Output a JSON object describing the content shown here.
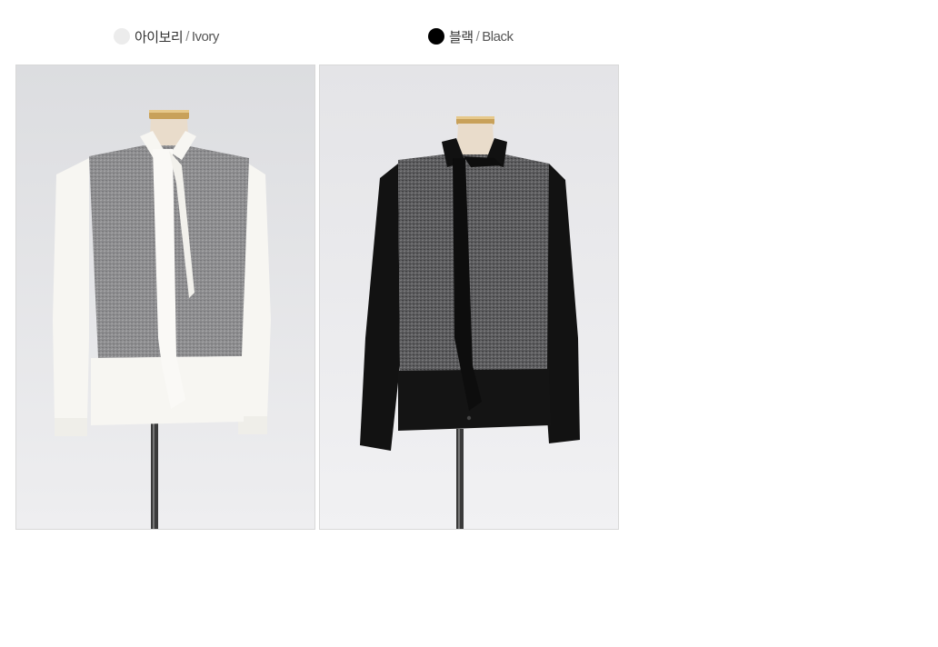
{
  "colors": [
    {
      "korean": "아이보리",
      "slash": "/",
      "english": "Ivory",
      "dot_color": "#ececec",
      "photo_alt": "Ivory color-block tie-neck blouse on mannequin"
    },
    {
      "korean": "블랙",
      "slash": "/",
      "english": "Black",
      "dot_color": "#000000",
      "photo_alt": "Black color-block tie-neck blouse on mannequin"
    }
  ]
}
